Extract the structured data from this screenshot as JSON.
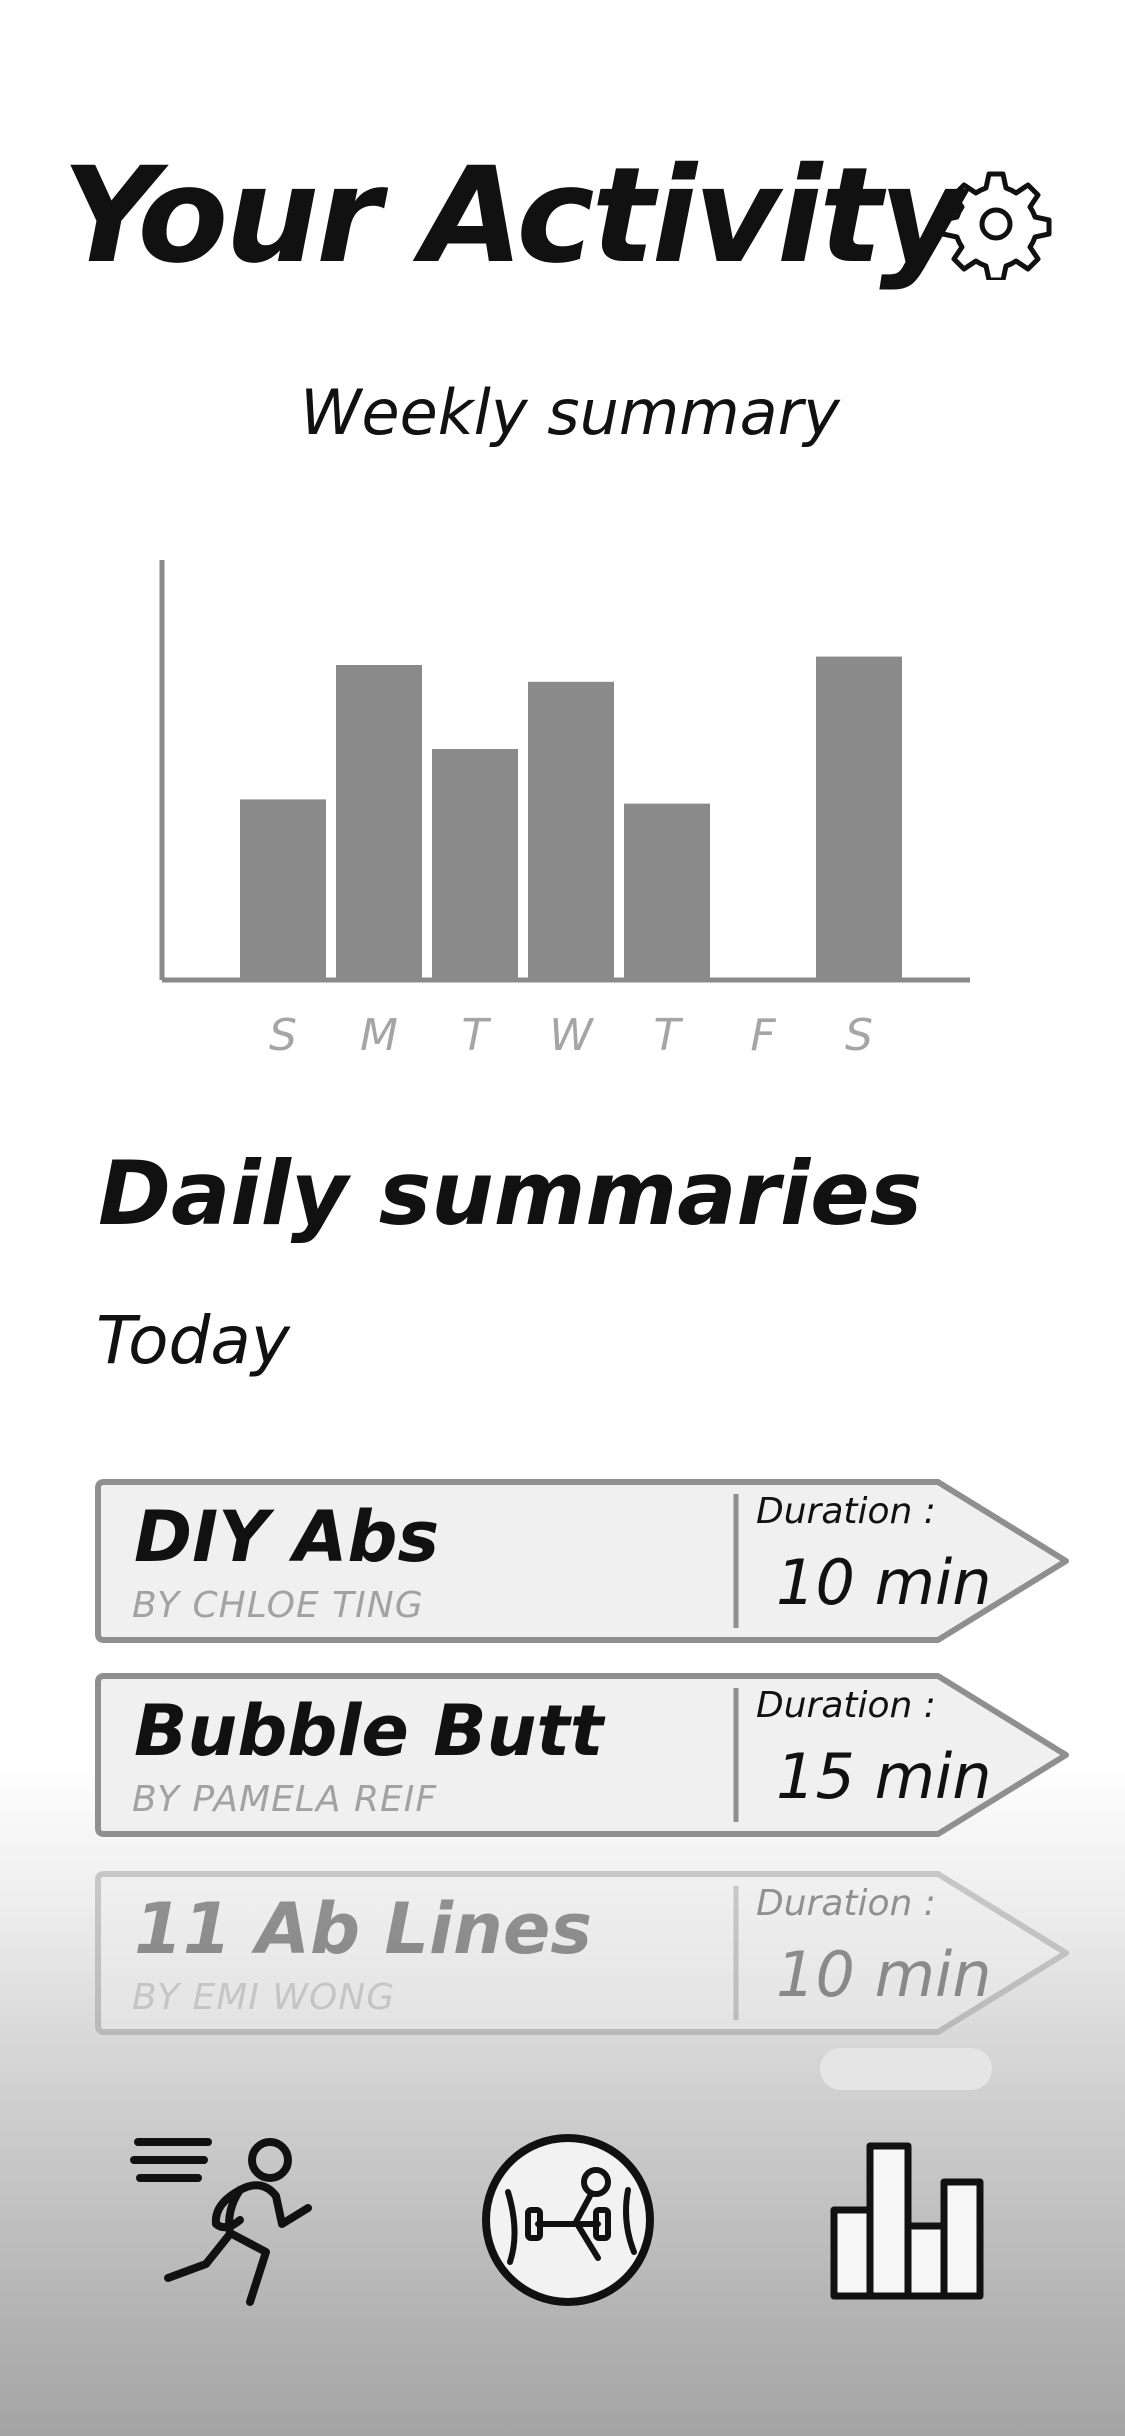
{
  "header": {
    "title": "Your Activity",
    "settings_icon": "gear-icon"
  },
  "weekly": {
    "subtitle": "Weekly summary"
  },
  "chart_data": {
    "type": "bar",
    "title": "Weekly summary",
    "categories": [
      "S",
      "M",
      "T",
      "W",
      "T",
      "F",
      "S"
    ],
    "values": [
      4.3,
      7.5,
      5.5,
      7.1,
      4.2,
      0,
      7.7
    ],
    "ylim": [
      0,
      10
    ],
    "xlabel": "",
    "ylabel": "",
    "grid": false,
    "bar_color": "#8a8a8a",
    "axis_color": "#8a8a8a",
    "tick_color": "#a5a5a5"
  },
  "daily": {
    "section_title": "Daily summaries",
    "day_label": "Today",
    "duration_label": "Duration :",
    "items": [
      {
        "name": "DIY Abs",
        "author": "BY CHLOE TING",
        "duration": "10 min"
      },
      {
        "name": "Bubble Butt",
        "author": "BY PAMELA REIF",
        "duration": "15 min"
      },
      {
        "name": "11 Ab Lines",
        "author": "BY EMI WONG",
        "duration": "10 min"
      }
    ]
  },
  "tabbar": {
    "tabs": [
      {
        "icon": "running-person-icon"
      },
      {
        "icon": "workout-globe-icon"
      },
      {
        "icon": "bar-chart-icon"
      }
    ]
  },
  "colors": {
    "card_fill": "#f0f0f0",
    "card_stroke": "#8f8f8f",
    "secondary_text": "#a2a2a2"
  }
}
